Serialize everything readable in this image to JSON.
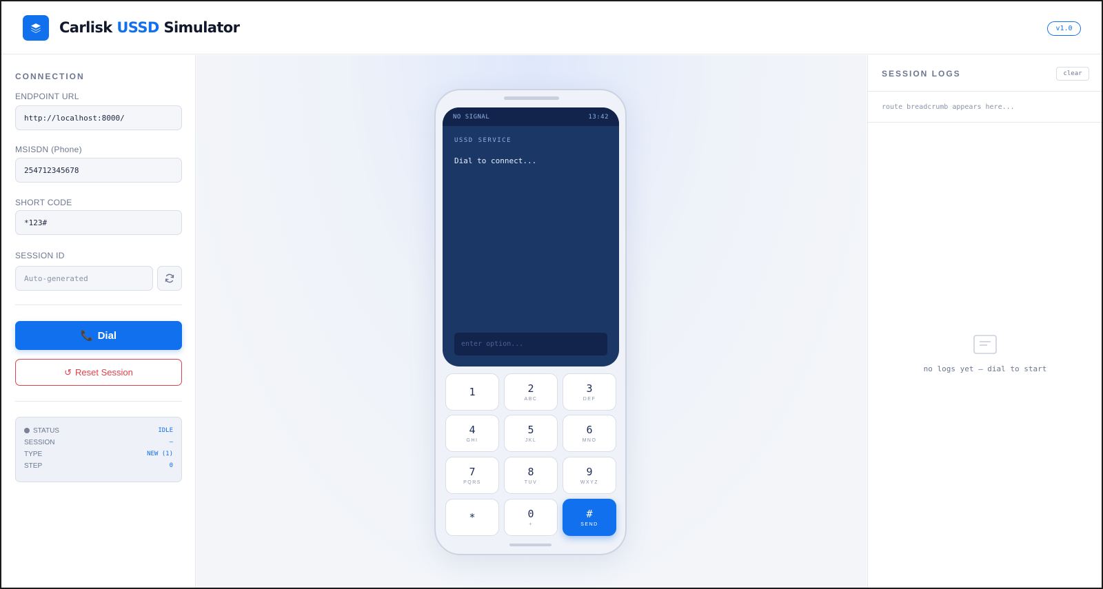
{
  "header": {
    "brand_prefix": "Carlisk",
    "brand_accent": "USSD",
    "brand_suffix": "Simulator",
    "version": "v1.0",
    "colors": {
      "accent": "#1170ee",
      "danger": "#e0404a"
    }
  },
  "sidebar": {
    "section_title": "CONNECTION",
    "endpoint": {
      "label": "ENDPOINT URL",
      "value": "http://localhost:8000/"
    },
    "msisdn": {
      "label": "MSISDN (Phone)",
      "value": "254712345678"
    },
    "short_code": {
      "label": "SHORT CODE",
      "value": "*123#"
    },
    "session_id": {
      "label": "SESSION ID",
      "placeholder": "Auto-generated",
      "refresh_icon": "refresh-icon"
    },
    "dial_label": "Dial",
    "dial_icon": "📞",
    "reset_label": "Reset Session",
    "reset_icon": "↺",
    "status": {
      "rows": [
        {
          "key": "STATUS",
          "value": "IDLE"
        },
        {
          "key": "SESSION",
          "value": "–"
        },
        {
          "key": "TYPE",
          "value": "NEW (1)"
        },
        {
          "key": "STEP",
          "value": "0"
        }
      ]
    }
  },
  "phone": {
    "signal": "NO SIGNAL",
    "time": "13:42",
    "service_title": "USSD SERVICE",
    "message": "Dial to connect...",
    "input_placeholder": "enter option...",
    "keys": [
      {
        "num": "1",
        "sub": ""
      },
      {
        "num": "2",
        "sub": "ABC"
      },
      {
        "num": "3",
        "sub": "DEF"
      },
      {
        "num": "4",
        "sub": "GHI"
      },
      {
        "num": "5",
        "sub": "JKL"
      },
      {
        "num": "6",
        "sub": "MNO"
      },
      {
        "num": "7",
        "sub": "PQRS"
      },
      {
        "num": "8",
        "sub": "TUV"
      },
      {
        "num": "9",
        "sub": "WXYZ"
      },
      {
        "num": "*",
        "sub": ""
      },
      {
        "num": "0",
        "sub": "+"
      },
      {
        "num": "#",
        "sub": "SEND"
      }
    ]
  },
  "logs": {
    "title": "SESSION LOGS",
    "clear_label": "clear",
    "breadcrumb": "route breadcrumb appears here...",
    "empty_text": "no logs yet — dial to start"
  }
}
